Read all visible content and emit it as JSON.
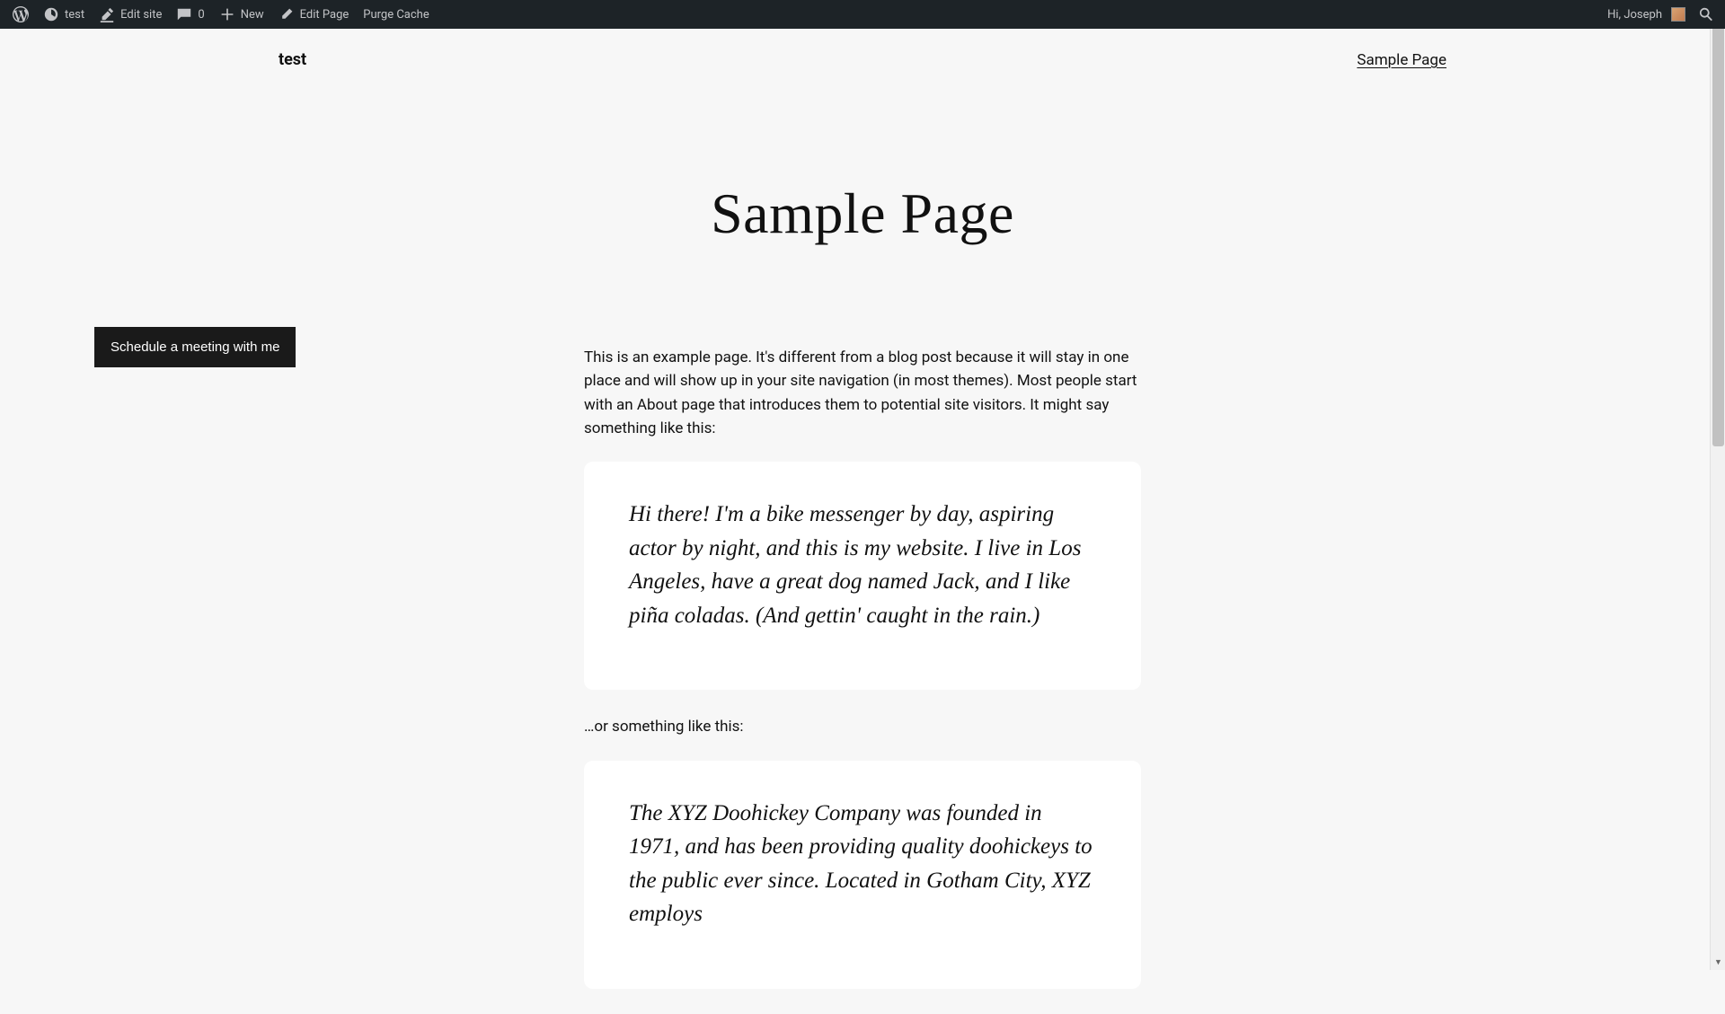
{
  "admin_bar": {
    "site_name": "test",
    "edit_site": "Edit site",
    "comments": "0",
    "new": "New",
    "edit_page": "Edit Page",
    "purge_cache": "Purge Cache",
    "greeting": "Hi, Joseph"
  },
  "header": {
    "site_title": "test",
    "nav_item": "Sample Page"
  },
  "page": {
    "title": "Sample Page",
    "intro": "This is an example page. It's different from a blog post because it will stay in one place and will show up in your site navigation (in most themes). Most people start with an About page that introduces them to potential site visitors. It might say something like this:",
    "quote1": "Hi there! I'm a bike messenger by day, aspiring actor by night, and this is my website. I live in Los Angeles, have a great dog named Jack, and I like piña coladas. (And gettin' caught in the rain.)",
    "mid": "…or something like this:",
    "quote2": "The XYZ Doohickey Company was founded in 1971, and has been providing quality doohickeys to the public ever since. Located in Gotham City, XYZ employs"
  },
  "schedule_button": "Schedule a meeting with me"
}
